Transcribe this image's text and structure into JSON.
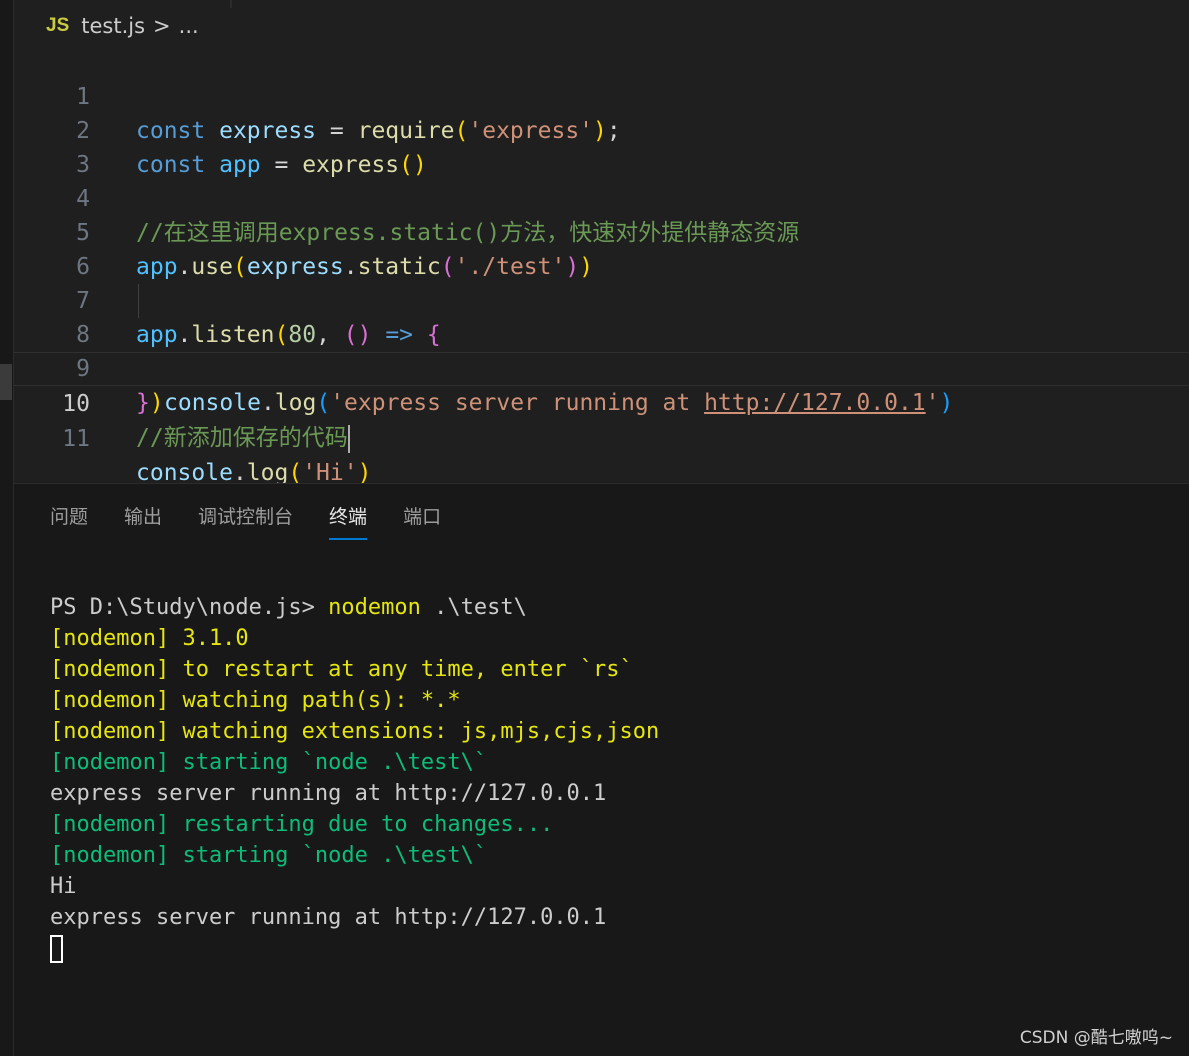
{
  "breadcrumb": {
    "lang_badge": "JS",
    "file": "test.js",
    "separator": ">",
    "more": "..."
  },
  "editor": {
    "lines": [
      {
        "n": "1"
      },
      {
        "n": "2"
      },
      {
        "n": "3"
      },
      {
        "n": "4"
      },
      {
        "n": "5"
      },
      {
        "n": "6"
      },
      {
        "n": "7"
      },
      {
        "n": "8"
      },
      {
        "n": "9"
      },
      {
        "n": "10"
      },
      {
        "n": "11"
      }
    ],
    "active_line": "10",
    "tokens": {
      "l1": [
        "const",
        " express ",
        "=",
        " ",
        "require",
        "(",
        "'express'",
        ")",
        ";"
      ],
      "l2": [
        "const",
        " ",
        "app",
        " = ",
        "express",
        "()"
      ],
      "l4": "//在这里调用express.static()方法，快速对外提供静态资源",
      "l5": [
        "app",
        ".",
        "use",
        "(",
        "express",
        ".",
        "static",
        "(",
        "'./test'",
        ")",
        ")"
      ],
      "l7": [
        "app",
        ".",
        "listen",
        "(",
        "80",
        ", ",
        "()",
        " ",
        "=>",
        " ",
        "{"
      ],
      "l8": [
        "console",
        ".",
        "log",
        "(",
        "'express server running at ",
        "http://127.0.0.1",
        "'",
        ")"
      ],
      "l9": [
        "}",
        ")"
      ],
      "l10": "//新添加保存的代码",
      "l11": [
        "console",
        ".",
        "log",
        "(",
        "'Hi'",
        ")"
      ]
    }
  },
  "panel": {
    "tabs": [
      "问题",
      "输出",
      "调试控制台",
      "终端",
      "端口"
    ],
    "active_tab": "终端"
  },
  "terminal": {
    "prompt": "PS D:\\Study\\node.js> ",
    "command": "nodemon",
    "command_args": " .\\test\\",
    "lines": [
      {
        "text": "[nodemon] 3.1.0",
        "color": "yellow"
      },
      {
        "text": "[nodemon] to restart at any time, enter `rs`",
        "color": "yellow"
      },
      {
        "text": "[nodemon] watching path(s): *.*",
        "color": "yellow"
      },
      {
        "text": "[nodemon] watching extensions: js,mjs,cjs,json",
        "color": "yellow"
      },
      {
        "text": "[nodemon] starting `node .\\test\\`",
        "color": "green"
      },
      {
        "text": "express server running at http://127.0.0.1",
        "color": "default"
      },
      {
        "text": "[nodemon] restarting due to changes...",
        "color": "green"
      },
      {
        "text": "[nodemon] starting `node .\\test\\`",
        "color": "green"
      },
      {
        "text": "Hi",
        "color": "default"
      },
      {
        "text": "express server running at http://127.0.0.1",
        "color": "default"
      }
    ]
  },
  "watermark": "CSDN @酷七嗷呜~",
  "colors": {
    "yellow": "#e5e510",
    "green": "#0dbc79",
    "default": "#cccccc",
    "accent": "#0078d4"
  }
}
